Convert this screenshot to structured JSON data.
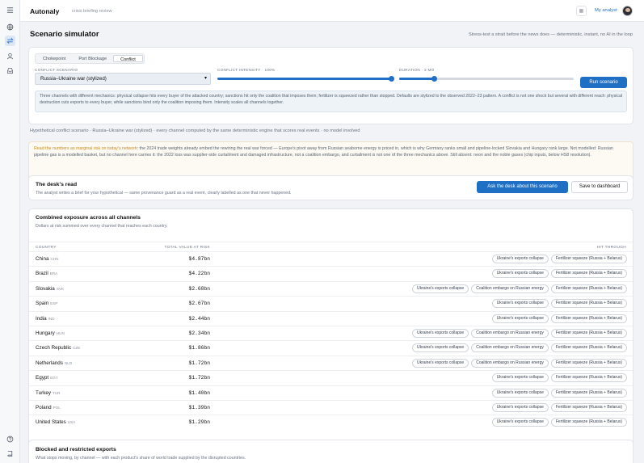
{
  "app": {
    "name": "Autonaly",
    "subtitle": "crisis briefing review",
    "user_link": "My analyst"
  },
  "rail": {
    "icons": [
      "menu-icon",
      "globe-icon",
      "swap-icon",
      "user-icon",
      "inbox-icon",
      "help-icon",
      "book-icon"
    ]
  },
  "page": {
    "title": "Scenario simulator",
    "subtitle": "Stress-test a strait before the news does — deterministic, instant, no AI in the loop"
  },
  "controls": {
    "tabs": [
      "Chokepoint",
      "Port Blockage",
      "Conflict"
    ],
    "active_tab": "Conflict",
    "scenario_label": "CONFLICT SCENARIO",
    "scenario_value": "Russia–Ukraine war (stylized)",
    "intensity_label": "CONFLICT INTENSITY · 100%",
    "intensity_fraction": 1.0,
    "duration_label": "DURATION · 3 MO",
    "duration_fraction": 0.2,
    "run_button": "Run scenario",
    "note": "Three channels with different mechanics: physical collapse hits every buyer of the attacked country; sanctions hit only the coalition that imposes them; fertilizer is squeezed rather than stopped. Defaults are stylized to the observed 2022–23 pattern. A conflict is not one shock but several with different reach: physical destruction cuts exports to every buyer, while sanctions bind only the coalition imposing them. Intensity scales all channels together."
  },
  "hypothetical_line": "Hypothetical conflict scenario · Russia–Ukraine war (stylized) · every channel computed by the same deterministic engine that scores real events · no model involved",
  "warning": {
    "highlight": "Read the numbers as marginal risk on today's network",
    "text": ": the 2024 trade weights already embed the rewiring the real war forced — Europe's pivot away from Russian seaborne energy is priced in, which is why Germany ranks small and pipeline-locked Slovakia and Hungary rank large. Not modelled: Russian pipeline gas is a modelled basket, but no channel here carries it: the 2022 loss was supplier-side curtailment and damaged infrastructure, not a coalition embargo, and curtailment is not one of the three mechanics above. Still absent: neon and the noble gases (chip inputs, below HS8 resolution)."
  },
  "desk": {
    "title": "The desk's read",
    "subtitle": "The analyst writes a brief for your hypothetical — same provenance guard as a real event, clearly labelled as one that never happened.",
    "ask_button": "Ask the desk about this scenario",
    "save_button": "Save to dashboard"
  },
  "exposure": {
    "title": "Combined exposure across all channels",
    "subtitle": "Dollars at risk summed over every channel that reaches each country.",
    "columns": [
      "COUNTRY",
      "TOTAL VALUE AT RISK",
      "HIT THROUGH"
    ],
    "rows": [
      {
        "country": "China",
        "code": "CHN",
        "value": "$4.87bn",
        "channels": [
          "Ukraine's exports collapse",
          "Fertilizer squeeze (Russia + Belarus)"
        ]
      },
      {
        "country": "Brazil",
        "code": "BRA",
        "value": "$4.22bn",
        "channels": [
          "Ukraine's exports collapse",
          "Fertilizer squeeze (Russia + Belarus)"
        ]
      },
      {
        "country": "Slovakia",
        "code": "SVK",
        "value": "$2.68bn",
        "channels": [
          "Ukraine's exports collapse",
          "Coalition embargo on Russian energy",
          "Fertilizer squeeze (Russia + Belarus)"
        ]
      },
      {
        "country": "Spain",
        "code": "ESP",
        "value": "$2.67bn",
        "channels": [
          "Ukraine's exports collapse",
          "Fertilizer squeeze (Russia + Belarus)"
        ]
      },
      {
        "country": "India",
        "code": "IND",
        "value": "$2.44bn",
        "channels": [
          "Ukraine's exports collapse",
          "Fertilizer squeeze (Russia + Belarus)"
        ]
      },
      {
        "country": "Hungary",
        "code": "HUN",
        "value": "$2.34bn",
        "channels": [
          "Ukraine's exports collapse",
          "Coalition embargo on Russian energy",
          "Fertilizer squeeze (Russia + Belarus)"
        ]
      },
      {
        "country": "Czech Republic",
        "code": "CZE",
        "value": "$1.86bn",
        "channels": [
          "Ukraine's exports collapse",
          "Coalition embargo on Russian energy",
          "Fertilizer squeeze (Russia + Belarus)"
        ]
      },
      {
        "country": "Netherlands",
        "code": "NLD",
        "value": "$1.72bn",
        "channels": [
          "Ukraine's exports collapse",
          "Coalition embargo on Russian energy",
          "Fertilizer squeeze (Russia + Belarus)"
        ]
      },
      {
        "country": "Egypt",
        "code": "EGY",
        "value": "$1.72bn",
        "channels": [
          "Ukraine's exports collapse",
          "Fertilizer squeeze (Russia + Belarus)"
        ]
      },
      {
        "country": "Turkey",
        "code": "TUR",
        "value": "$1.40bn",
        "channels": [
          "Ukraine's exports collapse",
          "Fertilizer squeeze (Russia + Belarus)"
        ]
      },
      {
        "country": "Poland",
        "code": "POL",
        "value": "$1.39bn",
        "channels": [
          "Ukraine's exports collapse",
          "Fertilizer squeeze (Russia + Belarus)"
        ]
      },
      {
        "country": "United States",
        "code": "USA",
        "value": "$1.29bn",
        "channels": [
          "Ukraine's exports collapse",
          "Fertilizer squeeze (Russia + Belarus)"
        ]
      }
    ]
  },
  "blocked": {
    "title": "Blocked and restricted exports",
    "subtitle": "What stops moving, by channel — with each product's share of world trade supplied by the disrupted countries."
  }
}
